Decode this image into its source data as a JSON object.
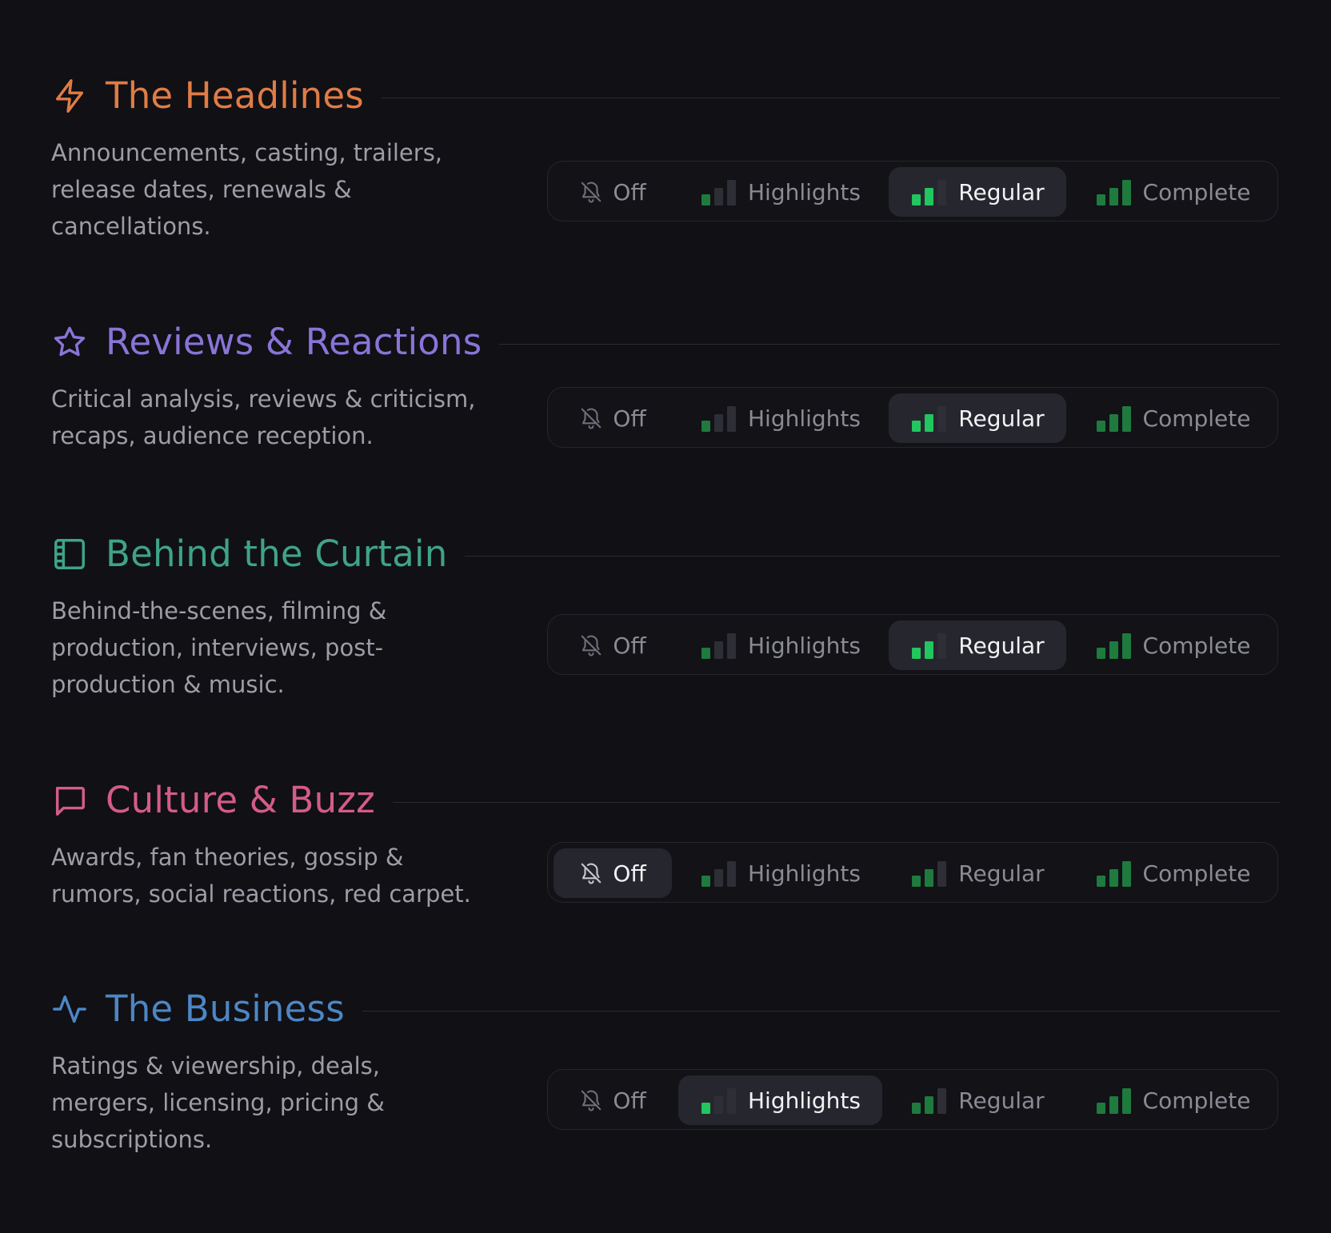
{
  "colors": {
    "background": "#101015",
    "headlines": "#e07c45",
    "reviews": "#8a74d6",
    "curtain": "#3fa387",
    "culture": "#d45c86",
    "business": "#4d86c4",
    "bar_active": "#22c55e",
    "bar_dim": "#1f7a3e",
    "bar_off": "#2e2f36"
  },
  "options": [
    "Off",
    "Highlights",
    "Regular",
    "Complete"
  ],
  "categories": [
    {
      "key": "headlines",
      "icon": "lightning-bolt-icon",
      "title": "The Headlines",
      "description": "Announcements, casting, trailers, release dates, renewals & cancellations.",
      "selected": "Regular"
    },
    {
      "key": "reviews",
      "icon": "star-icon",
      "title": "Reviews & Reactions",
      "description": "Critical analysis, reviews & criticism, recaps, audience reception.",
      "selected": "Regular"
    },
    {
      "key": "curtain",
      "icon": "film-strip-icon",
      "title": "Behind the Curtain",
      "description": "Behind-the-scenes, filming & production, interviews, post-production & music.",
      "selected": "Regular"
    },
    {
      "key": "culture",
      "icon": "chat-bubble-icon",
      "title": "Culture & Buzz",
      "description": "Awards, fan theories, gossip & rumors, social reactions, red carpet.",
      "selected": "Off"
    },
    {
      "key": "business",
      "icon": "activity-pulse-icon",
      "title": "The Business",
      "description": "Ratings & viewership, deals, mergers, licensing, pricing & subscriptions.",
      "selected": "Highlights"
    }
  ]
}
